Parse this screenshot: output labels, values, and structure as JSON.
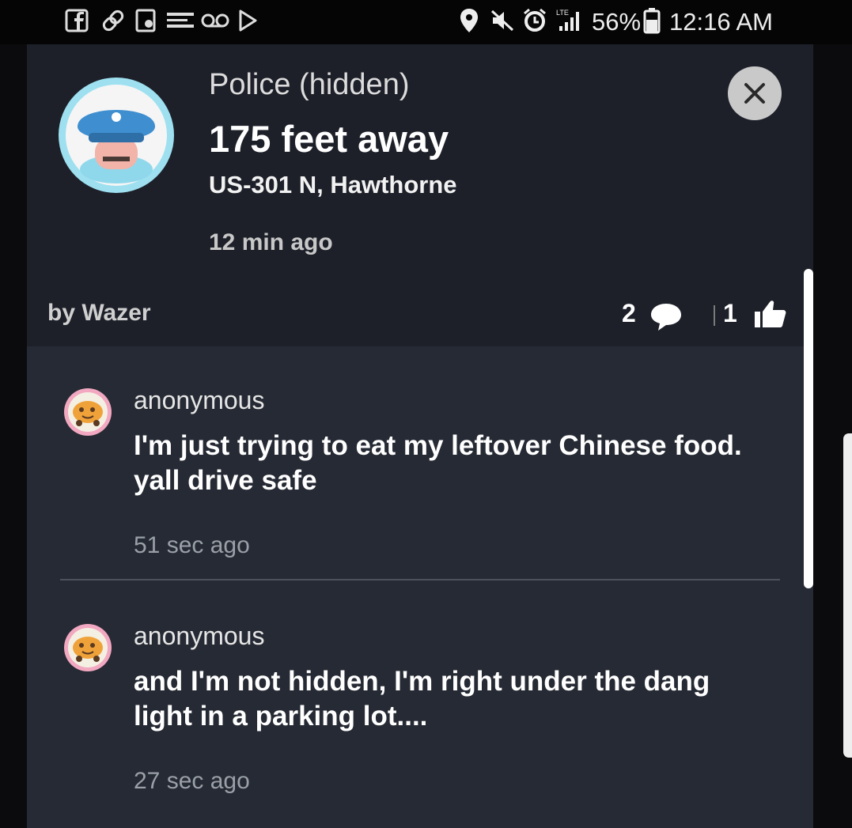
{
  "status_bar": {
    "battery_percent": "56%",
    "time": "12:16 AM",
    "left_icons": [
      "facebook-icon",
      "link-icon",
      "screenshot-icon",
      "amazon-icon",
      "voicemail-icon",
      "play-store-icon"
    ],
    "right_icons": [
      "location-icon",
      "mute-icon",
      "alarm-icon",
      "lte-signal-icon",
      "battery-icon"
    ]
  },
  "alert": {
    "type": "Police (hidden)",
    "distance": "175 feet away",
    "location": "US-301 N, Hawthorne",
    "time_ago": "12 min ago",
    "reporter": "by Wazer",
    "comment_count": "2",
    "like_count": "1"
  },
  "comments": [
    {
      "author": "anonymous",
      "text": "I'm just trying to eat my leftover Chinese food. yall drive safe",
      "time_ago": "51 sec ago"
    },
    {
      "author": "anonymous",
      "text": "and I'm not hidden, I'm right under the dang light in a parking lot....",
      "time_ago": "27 sec ago"
    }
  ],
  "colors": {
    "panel_background": "#262a34",
    "header_background": "#1d2029",
    "police_avatar_ring": "#9ee0f0",
    "police_hat": "#3f8fd0",
    "comment_avatar_bg": "#f2a8c0"
  }
}
